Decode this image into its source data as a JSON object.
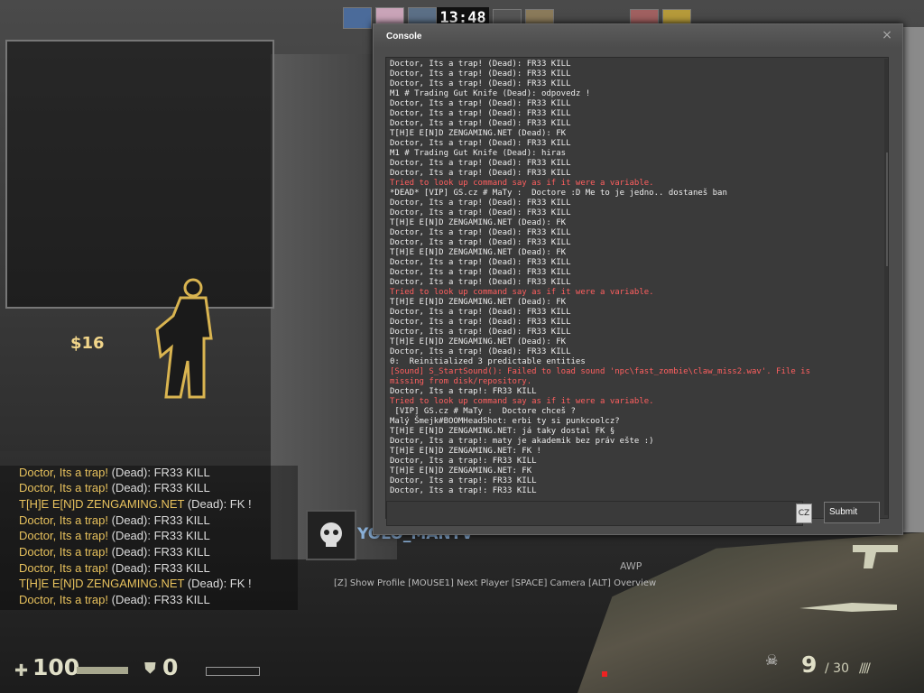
{
  "hud": {
    "clock": "13:48",
    "money": "$16",
    "health": "100",
    "armor": "0",
    "ammo_clip": "9",
    "ammo_reserve": "/ 30",
    "weapon_label": "AWP",
    "spectated_player": "YOLO_MANTV",
    "spectator_help": "[Z] Show Profile  [MOUSE1] Next Player [SPACE] Camera  [ALT] Overview"
  },
  "chat": [
    {
      "name": "Doctor, Its a trap!",
      "body": " (Dead): FR33 KILL"
    },
    {
      "name": "Doctor, Its a trap!",
      "body": " (Dead): FR33 KILL"
    },
    {
      "name": "T[H]E E[N]D ZENGAMING.NET",
      "body": " (Dead): FK !"
    },
    {
      "name": "Doctor, Its a trap!",
      "body": " (Dead): FR33 KILL"
    },
    {
      "name": "Doctor, Its a trap!",
      "body": " (Dead): FR33 KILL"
    },
    {
      "name": "Doctor, Its a trap!",
      "body": " (Dead): FR33 KILL"
    },
    {
      "name": "Doctor, Its a trap!",
      "body": " (Dead): FR33 KILL"
    },
    {
      "name": "T[H]E E[N]D ZENGAMING.NET",
      "body": " (Dead): FK !"
    },
    {
      "name": "Doctor, Its a trap!",
      "body": " (Dead): FR33 KILL"
    }
  ],
  "console": {
    "title": "Console",
    "close_label": "×",
    "lang_label": "CZ",
    "submit_label": "Submit",
    "input_value": "",
    "lines": [
      {
        "text": "Doctor, Its a trap! (Dead): FR33 KILL",
        "err": false
      },
      {
        "text": "Doctor, Its a trap! (Dead): FR33 KILL",
        "err": false
      },
      {
        "text": "Doctor, Its a trap! (Dead): FR33 KILL",
        "err": false
      },
      {
        "text": "M1 # Trading Gut Knife (Dead): odpovedz !",
        "err": false
      },
      {
        "text": "Doctor, Its a trap! (Dead): FR33 KILL",
        "err": false
      },
      {
        "text": "Doctor, Its a trap! (Dead): FR33 KILL",
        "err": false
      },
      {
        "text": "Doctor, Its a trap! (Dead): FR33 KILL",
        "err": false
      },
      {
        "text": "T[H]E E[N]D ZENGAMING.NET (Dead): FK",
        "err": false
      },
      {
        "text": "Doctor, Its a trap! (Dead): FR33 KILL",
        "err": false
      },
      {
        "text": "M1 # Trading Gut Knife (Dead): hiras",
        "err": false
      },
      {
        "text": "Doctor, Its a trap! (Dead): FR33 KILL",
        "err": false
      },
      {
        "text": "Doctor, Its a trap! (Dead): FR33 KILL",
        "err": false
      },
      {
        "text": "Tried to look up command say as if it were a variable.",
        "err": true
      },
      {
        "text": "*DEAD* [VIP] GS.cz # MaTy :  Doctore :D Me to je jedno.. dostaneš ban",
        "err": false
      },
      {
        "text": "Doctor, Its a trap! (Dead): FR33 KILL",
        "err": false
      },
      {
        "text": "Doctor, Its a trap! (Dead): FR33 KILL",
        "err": false
      },
      {
        "text": "T[H]E E[N]D ZENGAMING.NET (Dead): FK",
        "err": false
      },
      {
        "text": "Doctor, Its a trap! (Dead): FR33 KILL",
        "err": false
      },
      {
        "text": "Doctor, Its a trap! (Dead): FR33 KILL",
        "err": false
      },
      {
        "text": "T[H]E E[N]D ZENGAMING.NET (Dead): FK",
        "err": false
      },
      {
        "text": "Doctor, Its a trap! (Dead): FR33 KILL",
        "err": false
      },
      {
        "text": "Doctor, Its a trap! (Dead): FR33 KILL",
        "err": false
      },
      {
        "text": "Doctor, Its a trap! (Dead): FR33 KILL",
        "err": false
      },
      {
        "text": "Tried to look up command say as if it were a variable.",
        "err": true
      },
      {
        "text": "T[H]E E[N]D ZENGAMING.NET (Dead): FK",
        "err": false
      },
      {
        "text": "Doctor, Its a trap! (Dead): FR33 KILL",
        "err": false
      },
      {
        "text": "Doctor, Its a trap! (Dead): FR33 KILL",
        "err": false
      },
      {
        "text": "Doctor, Its a trap! (Dead): FR33 KILL",
        "err": false
      },
      {
        "text": "T[H]E E[N]D ZENGAMING.NET (Dead): FK",
        "err": false
      },
      {
        "text": "Doctor, Its a trap! (Dead): FR33 KILL",
        "err": false
      },
      {
        "text": "0:  Reinitialized 3 predictable entities",
        "err": false
      },
      {
        "text": "[Sound] S_StartSound(): Failed to load sound 'npc\\fast_zombie\\claw_miss2.wav'. File is",
        "err": true
      },
      {
        "text": "missing from disk/repository.",
        "err": true
      },
      {
        "text": "Doctor, Its a trap!: FR33 KILL",
        "err": false
      },
      {
        "text": "Tried to look up command say as if it were a variable.",
        "err": true
      },
      {
        "text": " [VIP] GS.cz # MaTy :  Doctore chceš ?",
        "err": false
      },
      {
        "text": "Malý Šmejk#BOOMHeadShot: erbi ty si punkcoolcz?",
        "err": false
      },
      {
        "text": "T[H]E E[N]D ZENGAMING.NET: já taky dostal FK §",
        "err": false
      },
      {
        "text": "Doctor, Its a trap!: maty je akademik bez práv ešte :)",
        "err": false
      },
      {
        "text": "T[H]E E[N]D ZENGAMING.NET: FK !",
        "err": false
      },
      {
        "text": "Doctor, Its a trap!: FR33 KILL",
        "err": false
      },
      {
        "text": "T[H]E E[N]D ZENGAMING.NET: FK",
        "err": false
      },
      {
        "text": "Doctor, Its a trap!: FR33 KILL",
        "err": false
      },
      {
        "text": "Doctor, Its a trap!: FR33 KILL",
        "err": false
      }
    ]
  }
}
